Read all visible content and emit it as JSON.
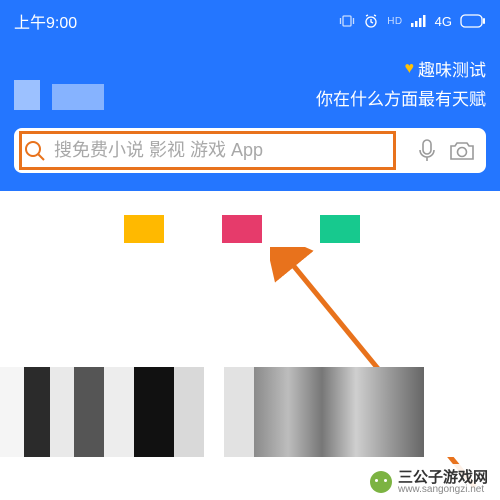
{
  "status": {
    "time": "上午9:00",
    "network": "4G",
    "hd": "HD"
  },
  "banner": {
    "heart": "♥",
    "line1": "趣味测试",
    "line2": "你在什么方面最有天赋"
  },
  "search": {
    "placeholder": "搜免费小说 影视 游戏 App"
  },
  "colors": {
    "primary": "#2476ff",
    "highlight": "#e8721c",
    "tile1": "#ffb900",
    "tile2": "#e63b6b",
    "tile3": "#17c98e"
  },
  "footer": {
    "text": "三公子游戏网",
    "url": "www.sangongzi.net"
  }
}
